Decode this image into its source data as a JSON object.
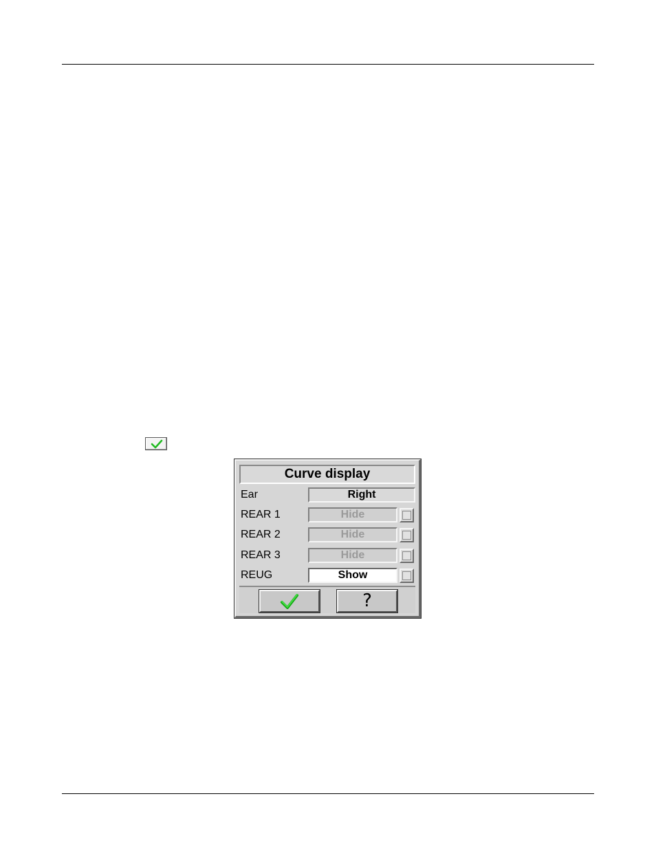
{
  "inline_icon": {
    "name": "checkmark-icon",
    "color": "#33cc33"
  },
  "dialog": {
    "title": "Curve display",
    "ear": {
      "label": "Ear",
      "value": "Right"
    },
    "rows": [
      {
        "label": "REAR 1",
        "value": "Hide",
        "enabled": false
      },
      {
        "label": "REAR 2",
        "value": "Hide",
        "enabled": false
      },
      {
        "label": "REAR 3",
        "value": "Hide",
        "enabled": false
      },
      {
        "label": "REUG",
        "value": "Show",
        "enabled": true
      }
    ],
    "buttons": {
      "ok_icon": "checkmark-icon",
      "help_label": "?"
    }
  }
}
